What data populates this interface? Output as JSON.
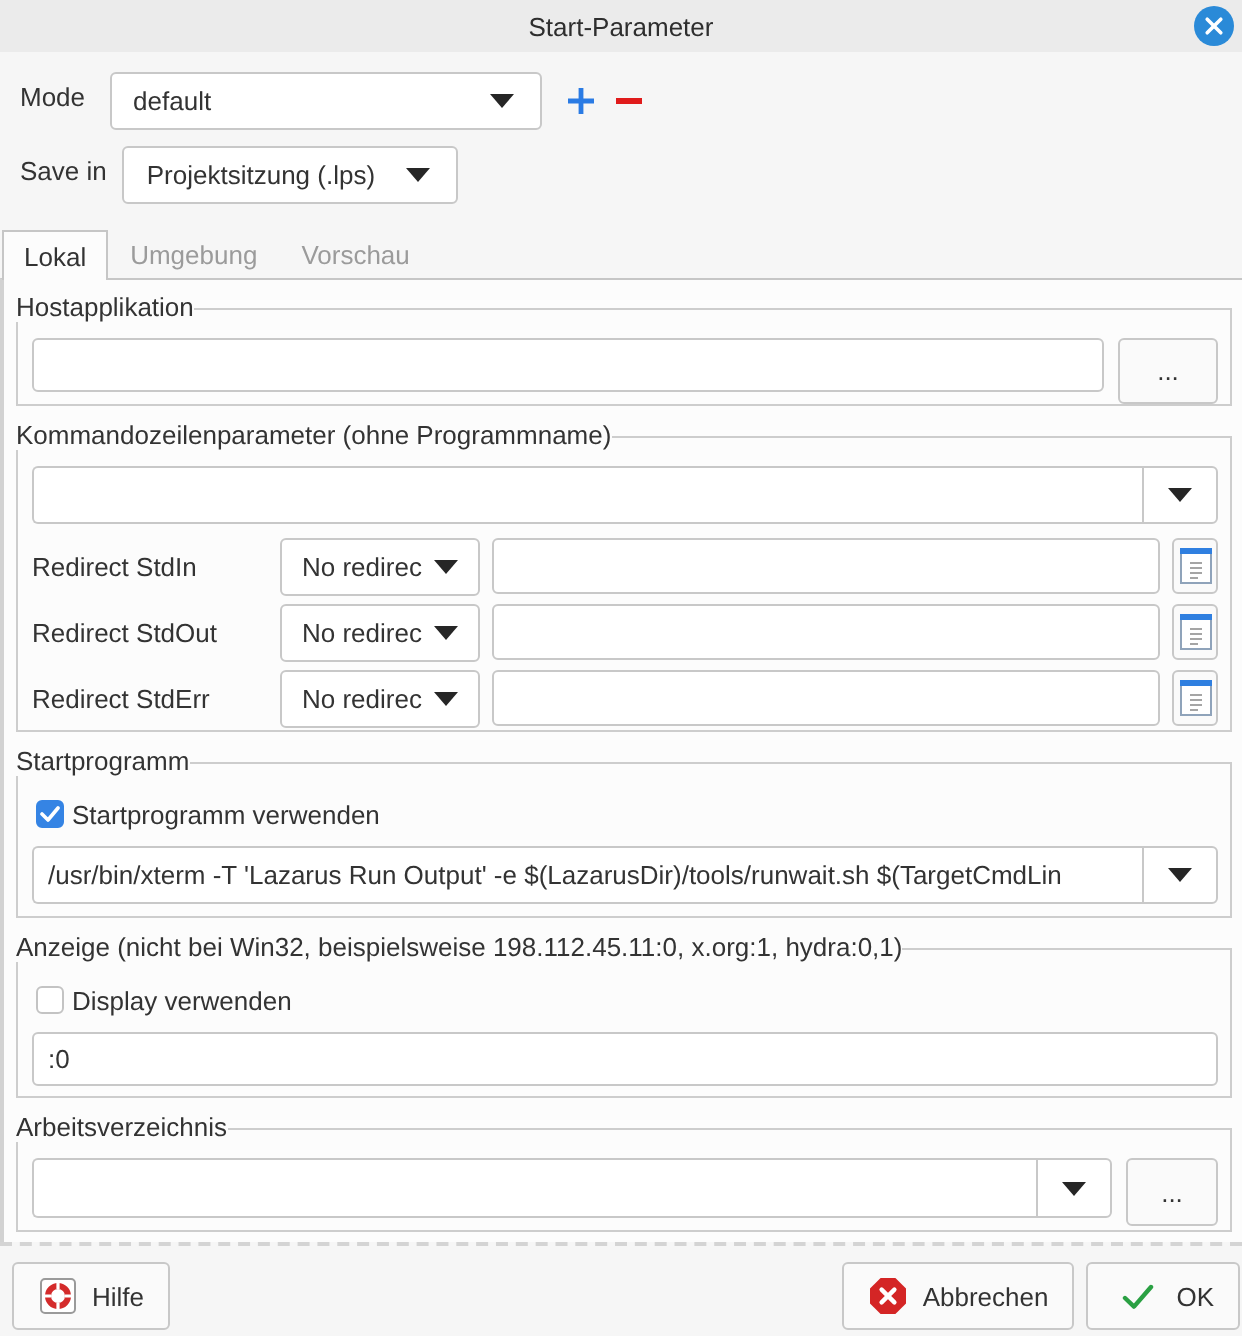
{
  "window": {
    "title": "Start-Parameter"
  },
  "mode": {
    "label": "Mode",
    "value": "default"
  },
  "save_in": {
    "label": "Save in",
    "value": "Projektsitzung (.lps)"
  },
  "tabs": [
    {
      "label": "Lokal",
      "selected": true
    },
    {
      "label": "Umgebung",
      "selected": false
    },
    {
      "label": "Vorschau",
      "selected": false
    }
  ],
  "host_application": {
    "caption": "Hostapplikation",
    "browse_button": "..."
  },
  "command_line": {
    "caption": "Kommandozeilenparameter (ohne Programmname)",
    "redirects": [
      {
        "label": "Redirect StdIn",
        "mode": "No redirec"
      },
      {
        "label": "Redirect StdOut",
        "mode": "No redirec"
      },
      {
        "label": "Redirect StdErr",
        "mode": "No redirec"
      }
    ]
  },
  "launcher": {
    "caption": "Startprogramm",
    "use": {
      "label": "Startprogramm verwenden",
      "checked": true
    },
    "command": "/usr/bin/xterm -T 'Lazarus Run Output' -e $(LazarusDir)/tools/runwait.sh $(TargetCmdLin"
  },
  "display": {
    "caption": "Anzeige (nicht bei Win32, beispielsweise 198.112.45.11:0, x.org:1, hydra:0,1)",
    "use": {
      "label": "Display verwenden",
      "checked": false
    },
    "value": ":0"
  },
  "working_directory": {
    "caption": "Arbeitsverzeichnis",
    "browse_button": "..."
  },
  "buttons": [
    {
      "label": "Hilfe",
      "kind": "help"
    },
    {
      "label": "Abbrechen",
      "kind": "cancel"
    },
    {
      "label": "OK",
      "kind": "ok"
    }
  ]
}
